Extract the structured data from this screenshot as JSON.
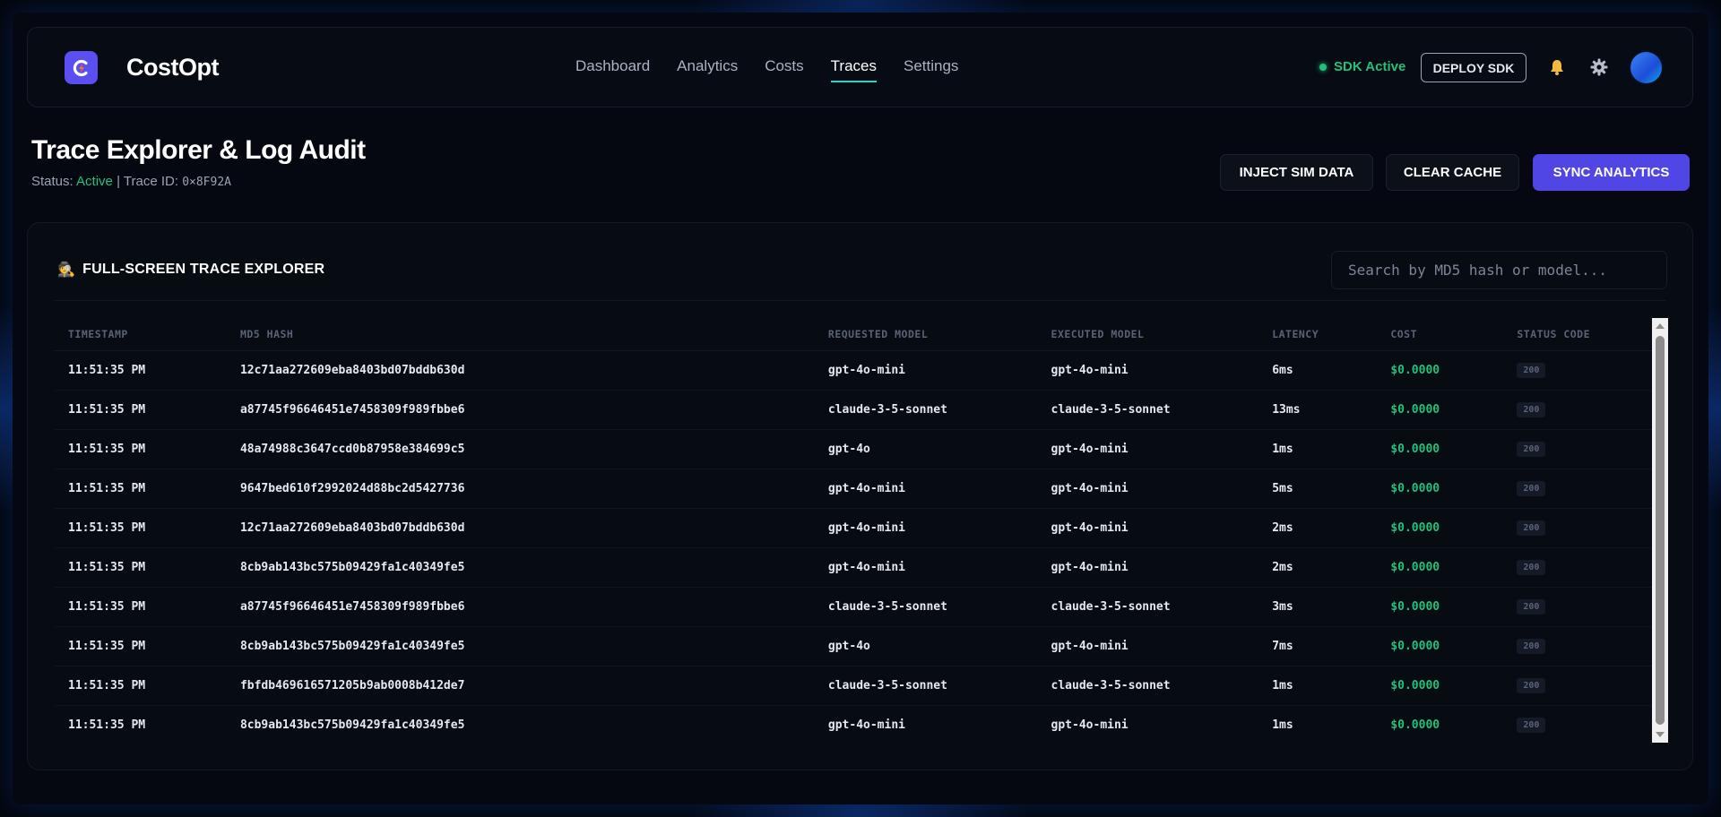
{
  "app": {
    "brand": "CostOpt",
    "accent": "#5046e5",
    "status_green": "#22c07a"
  },
  "nav": {
    "links": [
      {
        "label": "Dashboard",
        "active": false
      },
      {
        "label": "Analytics",
        "active": false
      },
      {
        "label": "Costs",
        "active": false
      },
      {
        "label": "Traces",
        "active": true
      },
      {
        "label": "Settings",
        "active": false
      }
    ],
    "sdk_status": "SDK Active",
    "deploy_label": "DEPLOY SDK",
    "icons": [
      "bell-icon",
      "gear-icon",
      "avatar"
    ]
  },
  "header": {
    "title": "Trace Explorer & Log Audit",
    "status_label": "Status:",
    "status_value": "Active",
    "separator": "|",
    "trace_label": "Trace ID:",
    "trace_id": "0×8F92A",
    "buttons": {
      "inject": "INJECT SIM DATA",
      "clear": "CLEAR CACHE",
      "sync": "SYNC ANALYTICS"
    }
  },
  "panel": {
    "title_icon": "🕵️",
    "title": "FULL-SCREEN TRACE EXPLORER",
    "search_placeholder": "Search by MD5 hash or model...",
    "columns": [
      "TIMESTAMP",
      "MD5 HASH",
      "REQUESTED MODEL",
      "EXECUTED MODEL",
      "LATENCY",
      "COST",
      "STATUS CODE"
    ],
    "rows": [
      {
        "timestamp": "11:51:35 PM",
        "hash": "12c71aa272609eba8403bd07bddb630d",
        "requested": "gpt-4o-mini",
        "executed": "gpt-4o-mini",
        "latency": "6ms",
        "cost": "$0.0000",
        "status": "200"
      },
      {
        "timestamp": "11:51:35 PM",
        "hash": "a87745f96646451e7458309f989fbbe6",
        "requested": "claude-3-5-sonnet",
        "executed": "claude-3-5-sonnet",
        "latency": "13ms",
        "cost": "$0.0000",
        "status": "200"
      },
      {
        "timestamp": "11:51:35 PM",
        "hash": "48a74988c3647ccd0b87958e384699c5",
        "requested": "gpt-4o",
        "executed": "gpt-4o-mini",
        "latency": "1ms",
        "cost": "$0.0000",
        "status": "200"
      },
      {
        "timestamp": "11:51:35 PM",
        "hash": "9647bed610f2992024d88bc2d5427736",
        "requested": "gpt-4o-mini",
        "executed": "gpt-4o-mini",
        "latency": "5ms",
        "cost": "$0.0000",
        "status": "200"
      },
      {
        "timestamp": "11:51:35 PM",
        "hash": "12c71aa272609eba8403bd07bddb630d",
        "requested": "gpt-4o-mini",
        "executed": "gpt-4o-mini",
        "latency": "2ms",
        "cost": "$0.0000",
        "status": "200"
      },
      {
        "timestamp": "11:51:35 PM",
        "hash": "8cb9ab143bc575b09429fa1c40349fe5",
        "requested": "gpt-4o-mini",
        "executed": "gpt-4o-mini",
        "latency": "2ms",
        "cost": "$0.0000",
        "status": "200"
      },
      {
        "timestamp": "11:51:35 PM",
        "hash": "a87745f96646451e7458309f989fbbe6",
        "requested": "claude-3-5-sonnet",
        "executed": "claude-3-5-sonnet",
        "latency": "3ms",
        "cost": "$0.0000",
        "status": "200"
      },
      {
        "timestamp": "11:51:35 PM",
        "hash": "8cb9ab143bc575b09429fa1c40349fe5",
        "requested": "gpt-4o",
        "executed": "gpt-4o-mini",
        "latency": "7ms",
        "cost": "$0.0000",
        "status": "200"
      },
      {
        "timestamp": "11:51:35 PM",
        "hash": "fbfdb469616571205b9ab0008b412de7",
        "requested": "claude-3-5-sonnet",
        "executed": "claude-3-5-sonnet",
        "latency": "1ms",
        "cost": "$0.0000",
        "status": "200"
      },
      {
        "timestamp": "11:51:35 PM",
        "hash": "8cb9ab143bc575b09429fa1c40349fe5",
        "requested": "gpt-4o-mini",
        "executed": "gpt-4o-mini",
        "latency": "1ms",
        "cost": "$0.0000",
        "status": "200"
      }
    ]
  }
}
